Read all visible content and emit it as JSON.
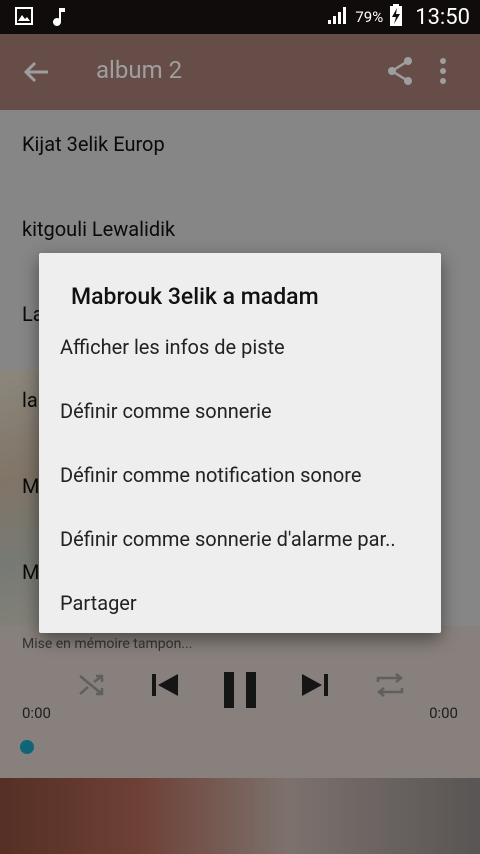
{
  "status_bar": {
    "battery_percent": "79%",
    "time": "13:50",
    "left_icons": [
      "image-notification-icon",
      "music-note-icon"
    ]
  },
  "toolbar": {
    "title": "album 2"
  },
  "tracks": [
    "Kijat 3elik Europ",
    "kitgouli Lewalidik",
    "La",
    "la",
    "M",
    "M"
  ],
  "player": {
    "status_text": "Mise en mémoire tampon...",
    "time_elapsed": "0:00",
    "time_total": "0:00",
    "progress": 0
  },
  "dialog": {
    "title": "Mabrouk 3elik a madam",
    "items": [
      "Afficher les infos de piste",
      "Définir comme sonnerie",
      "Définir comme notification sonore",
      "Définir comme sonnerie d'alarme par..",
      "Partager"
    ]
  },
  "colors": {
    "toolbar": "#a67c73",
    "accent": "#1aa2c2",
    "dialog_bg": "#eeeeee"
  }
}
